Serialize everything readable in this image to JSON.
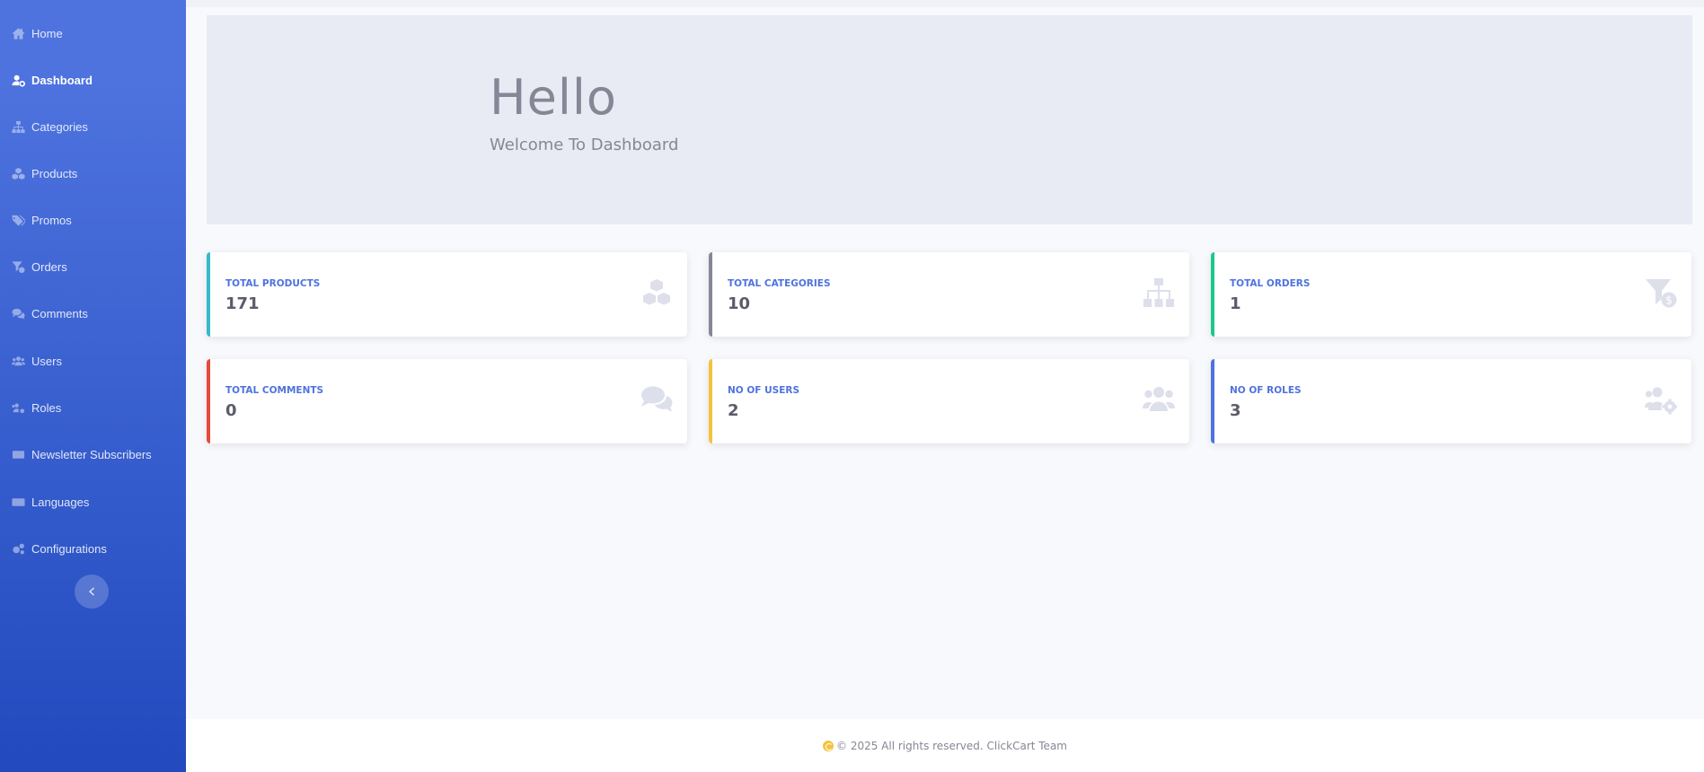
{
  "sidebar": {
    "items": [
      {
        "label": "Home",
        "icon": "home-icon"
      },
      {
        "label": "Dashboard",
        "icon": "user-cog-icon",
        "active": true
      },
      {
        "label": "Categories",
        "icon": "sitemap-icon"
      },
      {
        "label": "Products",
        "icon": "cubes-icon"
      },
      {
        "label": "Promos",
        "icon": "tags-icon"
      },
      {
        "label": "Orders",
        "icon": "funnel-dollar-icon"
      },
      {
        "label": "Comments",
        "icon": "comments-icon"
      },
      {
        "label": "Users",
        "icon": "users-icon"
      },
      {
        "label": "Roles",
        "icon": "users-cog-icon"
      },
      {
        "label": "Newsletter Subscribers",
        "icon": "mail-bulk-icon"
      },
      {
        "label": "Languages",
        "icon": "language-icon"
      },
      {
        "label": "Configurations",
        "icon": "cogs-icon"
      }
    ],
    "toggle_icon": "chevron-left-icon"
  },
  "hero": {
    "title": "Hello",
    "subtitle": "Welcome To Dashboard"
  },
  "cards": [
    {
      "label": "TOTAL PRODUCTS",
      "value": "171",
      "icon": "cubes-icon",
      "color": "#36b9cc"
    },
    {
      "label": "TOTAL CATEGORIES",
      "value": "10",
      "icon": "sitemap-icon",
      "color": "#858796"
    },
    {
      "label": "TOTAL ORDERS",
      "value": "1",
      "icon": "funnel-dollar-icon",
      "color": "#1cc88a"
    },
    {
      "label": "TOTAL COMMENTS",
      "value": "0",
      "icon": "comments-icon",
      "color": "#e74a3b"
    },
    {
      "label": "NO OF USERS",
      "value": "2",
      "icon": "users-icon",
      "color": "#f6c23e"
    },
    {
      "label": "NO OF ROLES",
      "value": "3",
      "icon": "users-cog-icon",
      "color": "#4e73df"
    }
  ],
  "footer": {
    "text": "© 2025 All rights reserved. ClickCart Team"
  },
  "colors": {
    "sidebar_top": "#4e73df",
    "sidebar_bottom": "#224abe",
    "label_blue": "#4e73df"
  }
}
